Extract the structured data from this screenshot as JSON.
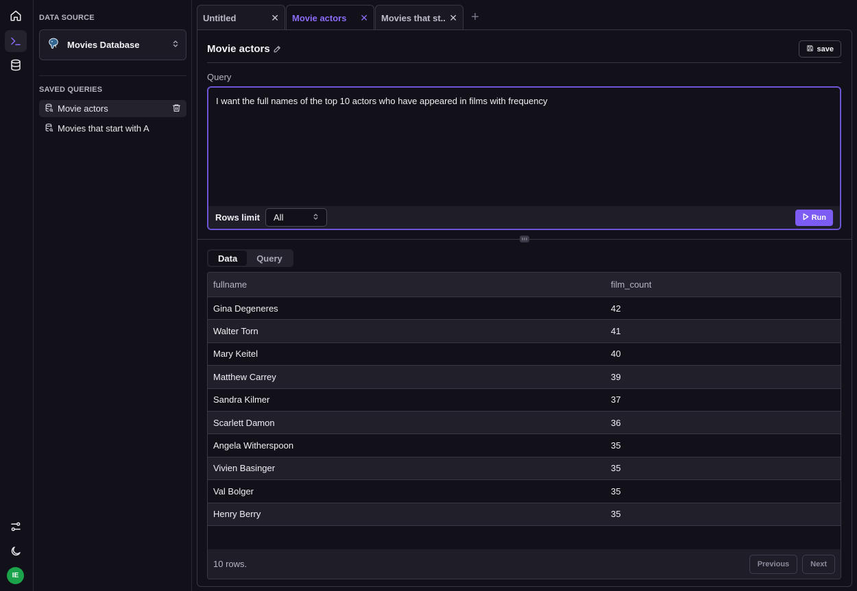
{
  "rail": {
    "avatar_initials": "IE"
  },
  "sidebar": {
    "data_source_title": "DATA SOURCE",
    "data_source_name": "Movies Database",
    "saved_queries_title": "SAVED QUERIES",
    "saved_queries": [
      {
        "label": "Movie actors",
        "active": true
      },
      {
        "label": "Movies that start with A",
        "active": false
      }
    ]
  },
  "tabs": [
    {
      "label": "Untitled",
      "active": false
    },
    {
      "label": "Movie actors",
      "active": true
    },
    {
      "label": "Movies that st...",
      "active": false
    }
  ],
  "query": {
    "title": "Movie actors",
    "save_label": "save",
    "section_label": "Query",
    "text": "I want the full names of the top 10 actors who have appeared in films with frequency",
    "rows_limit_label": "Rows limit",
    "rows_limit_value": "All",
    "run_label": "Run"
  },
  "results": {
    "tabs": [
      {
        "label": "Data",
        "active": true
      },
      {
        "label": "Query",
        "active": false
      }
    ],
    "columns": [
      "fullname",
      "film_count"
    ],
    "rows": [
      [
        "Gina Degeneres",
        "42"
      ],
      [
        "Walter Torn",
        "41"
      ],
      [
        "Mary Keitel",
        "40"
      ],
      [
        "Matthew Carrey",
        "39"
      ],
      [
        "Sandra Kilmer",
        "37"
      ],
      [
        "Scarlett Damon",
        "36"
      ],
      [
        "Angela Witherspoon",
        "35"
      ],
      [
        "Vivien Basinger",
        "35"
      ],
      [
        "Val Bolger",
        "35"
      ],
      [
        "Henry Berry",
        "35"
      ]
    ],
    "row_count": "10 rows.",
    "previous_label": "Previous",
    "next_label": "Next"
  },
  "colors": {
    "accent": "#7c5cf2",
    "background": "#121019",
    "avatar": "#1aa34a"
  }
}
